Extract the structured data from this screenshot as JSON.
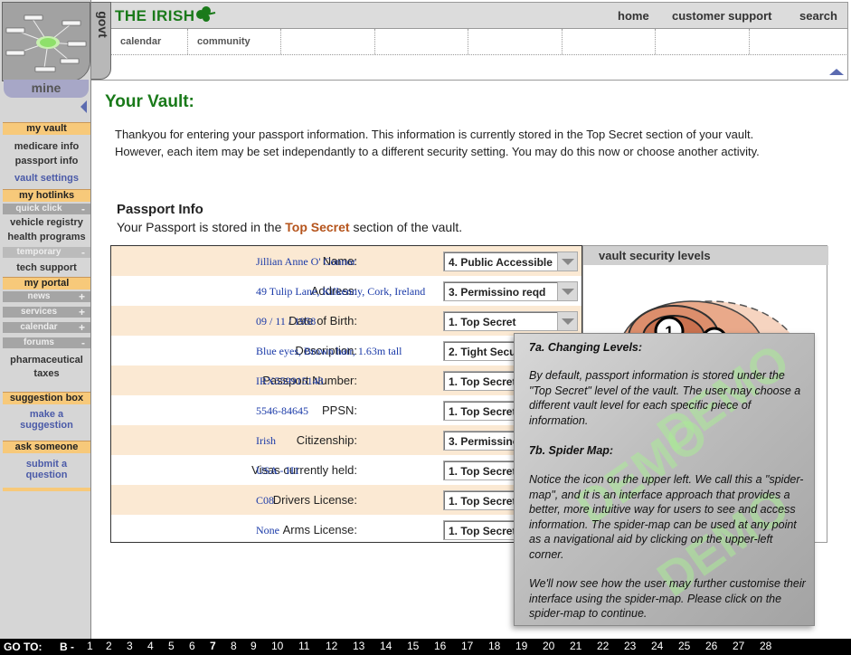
{
  "header": {
    "brand": "THE IRISH",
    "govt_tab": "govt",
    "nav": [
      "home",
      "customer support",
      "search"
    ],
    "subtabs": [
      "calendar",
      "community",
      "",
      "",
      "",
      "",
      "",
      ""
    ]
  },
  "sidebar": {
    "mine_tab": "mine",
    "my_vault": "my vault",
    "vault_items": [
      "medicare info",
      "passport info",
      "vault settings"
    ],
    "my_hotlinks": "my hotlinks",
    "quick_click": "quick click",
    "quick_click_sym": "-",
    "hotlinks": [
      "vehicle registry",
      "health programs"
    ],
    "temporary": "temporary",
    "temporary_sym": "-",
    "temp_items": [
      "tech support"
    ],
    "my_portal": "my portal",
    "portal_subs": [
      {
        "label": "news",
        "sym": "+"
      },
      {
        "label": "services",
        "sym": "+"
      },
      {
        "label": "calendar",
        "sym": "+"
      },
      {
        "label": "forums",
        "sym": "-"
      }
    ],
    "forum_items": [
      "pharmaceutical",
      "taxes"
    ],
    "suggestion_box": "suggestion box",
    "make_suggestion": [
      "make a",
      "suggestion"
    ],
    "ask_someone": "ask someone",
    "submit_question": [
      "submit a",
      "question"
    ]
  },
  "main": {
    "title": "Your Vault:",
    "intro": "Thankyou for entering your passport information. This information is currently stored in the Top Secret section of your vault. However, each item may be set independantly to a different security setting. You may do this now or choose another activity.",
    "passport_title": "Passport Info",
    "passport_sub_pre": "Your Passport is stored in the ",
    "passport_sub_em": "Top Secret",
    "passport_sub_post": " section of the vault."
  },
  "passport_rows": [
    {
      "label": "Name:",
      "value": "Jillian Anne O' Connor",
      "level": "4. Public Accessible"
    },
    {
      "label": "Address:",
      "value": "49 Tulip Lane, Kilkenny, Cork, Ireland",
      "level": "3. Permissino reqd"
    },
    {
      "label": "Date of Birth:",
      "value": "09 / 11 / 1958",
      "level": "1. Top Secret"
    },
    {
      "label": "Description:",
      "value": "Blue eyes, Brown hair, 1.63m tall",
      "level": "2. Tight Security"
    },
    {
      "label": "Passport Number:",
      "value": "IRX559915148",
      "level": "1. Top Secret"
    },
    {
      "label": "PPSN:",
      "value": "5546-84645",
      "level": "1. Top Secret"
    },
    {
      "label": "Citizenship:",
      "value": "Irish",
      "level": "3. Permissino reqd"
    },
    {
      "label": "Visas currently held:",
      "value": "USA - H1",
      "level": "1. Top Secret"
    },
    {
      "label": "Drivers License:",
      "value": "C08",
      "level": "1. Top Secret"
    },
    {
      "label": "Arms License:",
      "value": "None",
      "level": "1. Top Secret"
    }
  ],
  "levels_panel": {
    "title": "vault security levels",
    "ring_labels": [
      "1",
      "2"
    ]
  },
  "popup": {
    "h1": "7a. Changing Levels:",
    "p1": "By default, passport information is stored under the \"Top Secret\" level of the vault. The user may choose a different vault level for each specific piece of information.",
    "h2": "7b. Spider Map:",
    "p2": "Notice the icon on the upper left.  We call this a \"spider-map\", and it is an interface approach that provides a better, more intuitive way for users to see and access information.  The spider-map can be used at any point as a navigational aid by clicking on the upper-left corner.",
    "p3": "We'll now see how the user may further customise their interface using the spider-map. Please click on the spider-map to continue.",
    "watermark": "DEMO"
  },
  "footer": {
    "goto": "GO TO:",
    "b": "B -",
    "pages": [
      "1",
      "2",
      "3",
      "4",
      "5",
      "6",
      "7",
      "8",
      "9",
      "10",
      "11",
      "12",
      "13",
      "14",
      "15",
      "16",
      "17",
      "18",
      "19",
      "20",
      "21",
      "22",
      "23",
      "24",
      "25",
      "26",
      "27",
      "28"
    ],
    "current": "7"
  },
  "colors": {
    "brand": "#1a7a1a",
    "accent": "#b5541c",
    "nav_head": "#f7c97a",
    "link": "#1a3aa8"
  }
}
